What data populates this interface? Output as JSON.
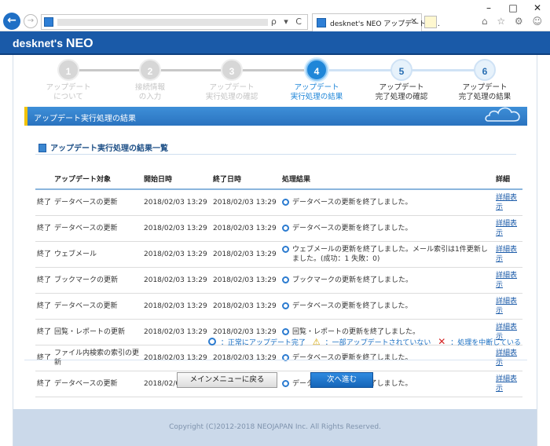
{
  "browser": {
    "tab_title": "desknet's NEO アップデートツ...",
    "address_icons": "ρ ▾ C",
    "window_controls": [
      "–",
      "□",
      "✕"
    ],
    "right_icons": "⌂ ☆ ⚙ ☺"
  },
  "app": {
    "logo_main": "desknet's ",
    "logo_neo": "NEO"
  },
  "steps": [
    {
      "num": "1",
      "label_l1": "アップデート",
      "label_l2": "について",
      "state": "done"
    },
    {
      "num": "2",
      "label_l1": "接続情報",
      "label_l2": "の入力",
      "state": "done"
    },
    {
      "num": "3",
      "label_l1": "アップデート",
      "label_l2": "実行処理の確認",
      "state": "done"
    },
    {
      "num": "4",
      "label_l1": "アップデート",
      "label_l2": "実行処理の結果",
      "state": "active"
    },
    {
      "num": "5",
      "label_l1": "アップデート",
      "label_l2": "完了処理の確認",
      "state": "todo"
    },
    {
      "num": "6",
      "label_l1": "アップデート",
      "label_l2": "完了処理の結果",
      "state": "todo"
    }
  ],
  "section": {
    "title": "アップデート実行処理の結果",
    "subtitle": "アップデート実行処理の結果一覧"
  },
  "table": {
    "headers": {
      "target": "アップデート対象",
      "start": "開始日時",
      "end": "終了日時",
      "result": "処理結果",
      "detail": "詳細"
    },
    "rows": [
      {
        "status": "終了",
        "target": "データベースの更新",
        "start": "2018/02/03 13:29",
        "end": "2018/02/03 13:29",
        "result": "データベースの更新を終了しました。",
        "detail": "詳細表示"
      },
      {
        "status": "終了",
        "target": "データベースの更新",
        "start": "2018/02/03 13:29",
        "end": "2018/02/03 13:29",
        "result": "データベースの更新を終了しました。",
        "detail": "詳細表示"
      },
      {
        "status": "終了",
        "target": "ウェブメール",
        "start": "2018/02/03 13:29",
        "end": "2018/02/03 13:29",
        "result": "ウェブメールの更新を終了しました。メール索引は1件更新しました。(成功：1 失敗：0)",
        "detail": "詳細表示"
      },
      {
        "status": "終了",
        "target": "ブックマークの更新",
        "start": "2018/02/03 13:29",
        "end": "2018/02/03 13:29",
        "result": "ブックマークの更新を終了しました。",
        "detail": "詳細表示"
      },
      {
        "status": "終了",
        "target": "データベースの更新",
        "start": "2018/02/03 13:29",
        "end": "2018/02/03 13:29",
        "result": "データベースの更新を終了しました。",
        "detail": "詳細表示"
      },
      {
        "status": "終了",
        "target": "回覧・レポートの更新",
        "start": "2018/02/03 13:29",
        "end": "2018/02/03 13:29",
        "result": "回覧・レポートの更新を終了しました。",
        "detail": "詳細表示"
      },
      {
        "status": "終了",
        "target": "ファイル内検索の索引の更新",
        "start": "2018/02/03 13:29",
        "end": "2018/02/03 13:29",
        "result": "データベースの更新を終了しました。",
        "detail": "詳細表示"
      },
      {
        "status": "終了",
        "target": "データベースの更新",
        "start": "2018/02/03 13:29",
        "end": "2018/02/03 13:29",
        "result": "データベースの更新を終了しました。",
        "detail": "詳細表示"
      }
    ]
  },
  "legend": {
    "ok": "：正常にアップデート完了",
    "warn": "：一部アップデートされていない",
    "error": "：処理を中断している"
  },
  "buttons": {
    "main_menu": "メインメニューに戻る",
    "next": "次へ進む"
  },
  "footer": "Copyright (C)2012-2018 NEOJAPAN Inc. All Rights Reserved."
}
